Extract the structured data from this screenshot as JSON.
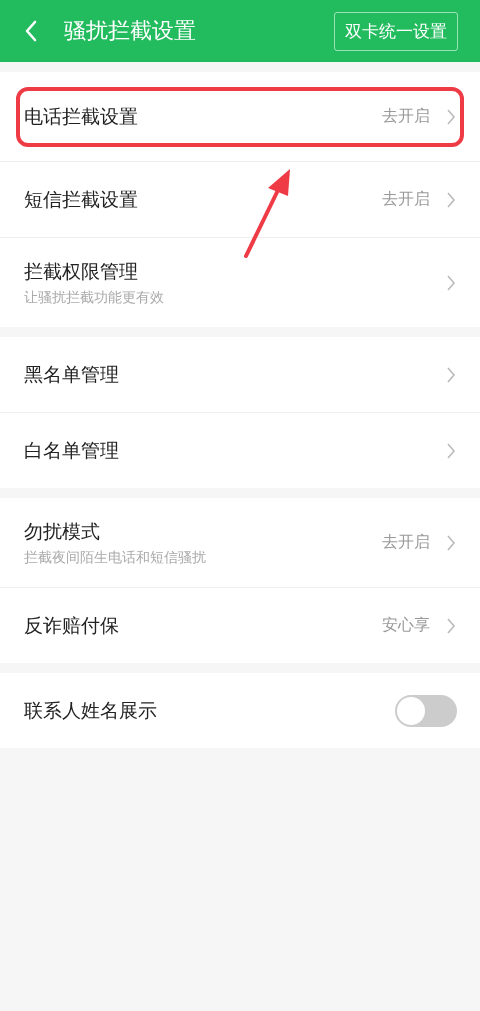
{
  "header": {
    "title": "骚扰拦截设置",
    "action": "双卡统一设置"
  },
  "groups": [
    {
      "rows": [
        {
          "kind": "link",
          "label": "电话拦截设置",
          "value": "去开启",
          "highlighted": true
        },
        {
          "kind": "link",
          "label": "短信拦截设置",
          "value": "去开启",
          "highlighted": false
        },
        {
          "kind": "link",
          "label": "拦截权限管理",
          "subtitle": "让骚扰拦截功能更有效",
          "highlighted": false
        }
      ]
    },
    {
      "rows": [
        {
          "kind": "link",
          "label": "黑名单管理",
          "highlighted": false
        },
        {
          "kind": "link",
          "label": "白名单管理",
          "highlighted": false
        }
      ]
    },
    {
      "rows": [
        {
          "kind": "link",
          "label": "勿扰模式",
          "subtitle": "拦截夜间陌生电话和短信骚扰",
          "value": "去开启",
          "highlighted": false
        },
        {
          "kind": "link",
          "label": "反诈赔付保",
          "value": "安心享",
          "highlighted": false
        }
      ]
    },
    {
      "rows": [
        {
          "kind": "toggle",
          "label": "联系人姓名展示",
          "on": false,
          "highlighted": false
        }
      ]
    }
  ]
}
